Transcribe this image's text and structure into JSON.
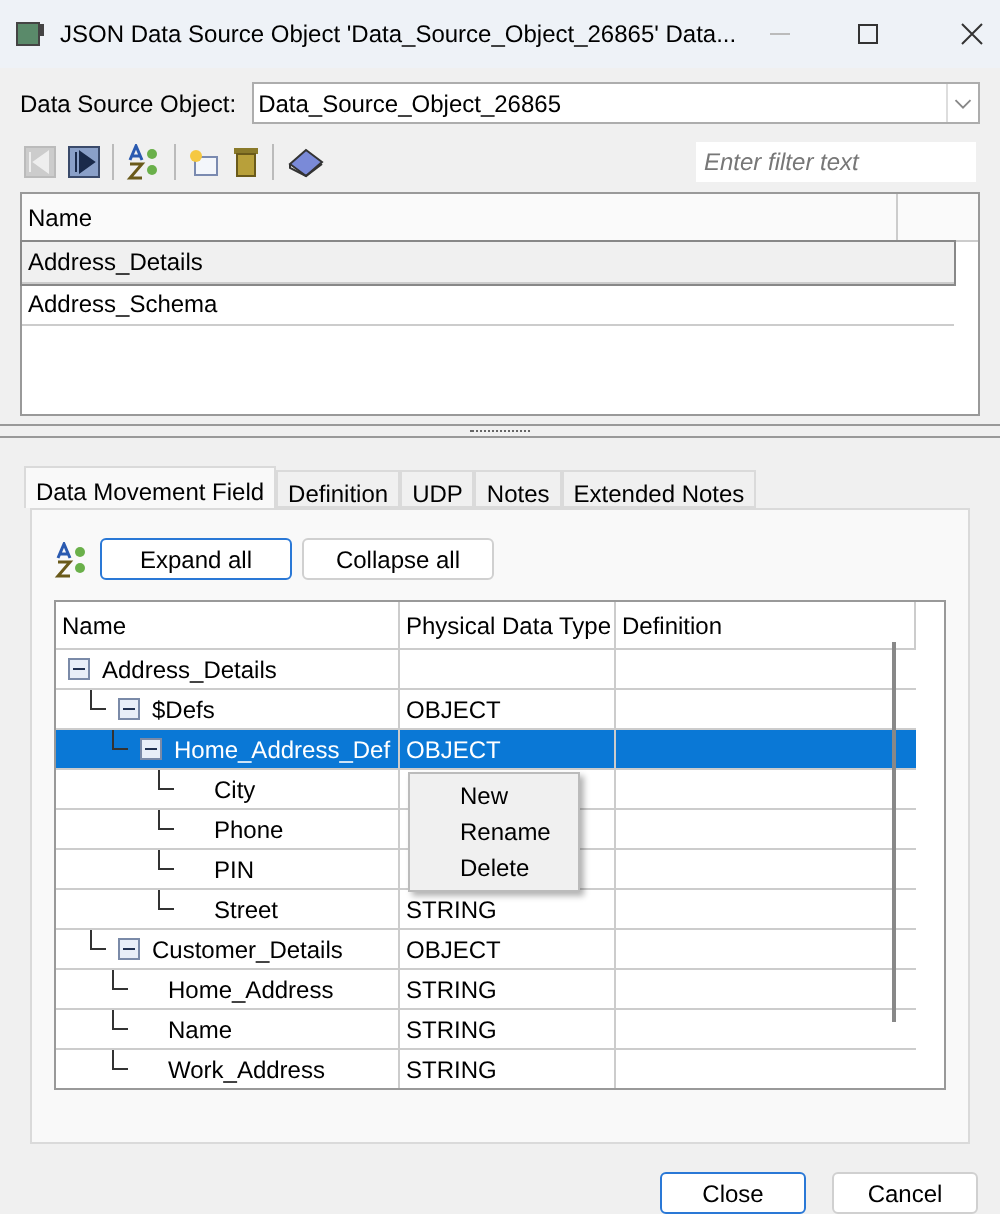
{
  "window": {
    "title": "JSON Data Source Object 'Data_Source_Object_26865' Data..."
  },
  "source": {
    "label": "Data Source Object:",
    "value": "Data_Source_Object_26865"
  },
  "filter": {
    "placeholder": "Enter filter text"
  },
  "objects": {
    "columns": [
      "Name"
    ],
    "rows": [
      {
        "name": "Address_Details",
        "selected": true
      },
      {
        "name": "Address_Schema",
        "selected": false
      }
    ]
  },
  "tabs": [
    {
      "label": "Data Movement Field",
      "selected": true
    },
    {
      "label": "Definition",
      "selected": false
    },
    {
      "label": "UDP",
      "selected": false
    },
    {
      "label": "Notes",
      "selected": false
    },
    {
      "label": "Extended Notes",
      "selected": false
    }
  ],
  "tree_buttons": [
    {
      "label": "Expand all",
      "selected": true
    },
    {
      "label": "Collapse all",
      "selected": false
    }
  ],
  "tree": {
    "columns": [
      "Name",
      "Physical Data Type",
      "Definition"
    ],
    "rows": [
      {
        "name": "Address_Details",
        "expanded": true,
        "selected": false,
        "children": [
          {
            "name": "$Defs",
            "type": "OBJECT",
            "expanded": true,
            "selected": false,
            "children": [
              {
                "name": "Home_Address_Def",
                "type": "OBJECT",
                "expanded": true,
                "selected": true,
                "children": [
                  {
                    "name": "City",
                    "selected": false
                  },
                  {
                    "name": "Phone",
                    "selected": false
                  },
                  {
                    "name": "PIN",
                    "selected": false
                  },
                  {
                    "name": "Street",
                    "type": "STRING",
                    "selected": false
                  }
                ]
              }
            ]
          },
          {
            "name": "Customer_Details",
            "type": "OBJECT",
            "expanded": true,
            "selected": false,
            "children": [
              {
                "name": "Home_Address",
                "type": "STRING",
                "selected": false
              },
              {
                "name": "Name",
                "type": "STRING",
                "selected": false
              },
              {
                "name": "Work_Address",
                "type": "STRING",
                "selected": false
              }
            ]
          }
        ]
      }
    ]
  },
  "context_menu": [
    "New",
    "Rename",
    "Delete"
  ],
  "buttons": [
    {
      "label": "Close",
      "selected": true
    },
    {
      "label": "Cancel",
      "selected": false
    }
  ]
}
